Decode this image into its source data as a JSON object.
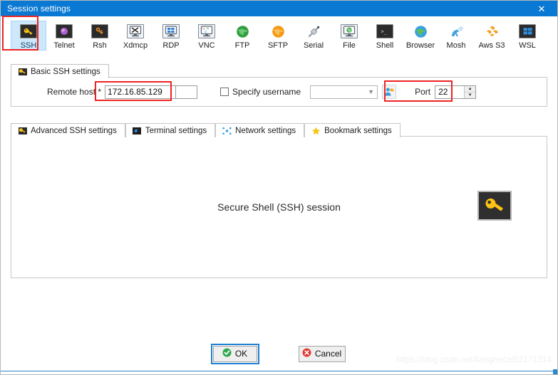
{
  "window": {
    "title": "Session settings",
    "close_label": "✕",
    "accent": "#0a79d4"
  },
  "toolbar": {
    "items": [
      {
        "label": "SSH",
        "icon": "ssh-key-icon",
        "selected": true
      },
      {
        "label": "Telnet",
        "icon": "telnet-icon",
        "selected": false
      },
      {
        "label": "Rsh",
        "icon": "rsh-icon",
        "selected": false
      },
      {
        "label": "Xdmcp",
        "icon": "xdmcp-icon",
        "selected": false
      },
      {
        "label": "RDP",
        "icon": "rdp-icon",
        "selected": false
      },
      {
        "label": "VNC",
        "icon": "vnc-icon",
        "selected": false
      },
      {
        "label": "FTP",
        "icon": "ftp-globe-icon",
        "selected": false
      },
      {
        "label": "SFTP",
        "icon": "sftp-globe-icon",
        "selected": false
      },
      {
        "label": "Serial",
        "icon": "serial-plug-icon",
        "selected": false
      },
      {
        "label": "File",
        "icon": "file-monitor-icon",
        "selected": false
      },
      {
        "label": "Shell",
        "icon": "shell-icon",
        "selected": false
      },
      {
        "label": "Browser",
        "icon": "browser-globe-icon",
        "selected": false
      },
      {
        "label": "Mosh",
        "icon": "mosh-dish-icon",
        "selected": false
      },
      {
        "label": "Aws S3",
        "icon": "aws-s3-icon",
        "selected": false
      },
      {
        "label": "WSL",
        "icon": "wsl-windows-icon",
        "selected": false
      }
    ]
  },
  "basic": {
    "tab_label": "Basic SSH settings",
    "tab_icon": "ssh-key-icon",
    "remote_host_label": "Remote host *",
    "remote_host_value": "172.16.85.129",
    "remote_host_placeholder": "",
    "specify_username_label": "Specify username",
    "specify_username_checked": false,
    "username_value": "",
    "username_placeholder": "",
    "user_button_icon": "user-key-icon",
    "port_label": "Port",
    "port_value": "22",
    "spin_up": "▲",
    "spin_down": "▼"
  },
  "settings_tabs": [
    {
      "label": "Advanced SSH settings",
      "icon": "ssh-key-icon",
      "active": true
    },
    {
      "label": "Terminal settings",
      "icon": "terminal-icon",
      "active": false
    },
    {
      "label": "Network settings",
      "icon": "network-icon",
      "active": false
    },
    {
      "label": "Bookmark settings",
      "icon": "star-icon",
      "active": false
    }
  ],
  "content": {
    "heading": "Secure Shell (SSH) session",
    "badge_icon": "key-icon"
  },
  "footer": {
    "ok_label": "OK",
    "cancel_label": "Cancel",
    "ok_icon": "check-circle-icon",
    "cancel_icon": "x-circle-icon"
  },
  "watermark": {
    "text": "https://blog.csdn.net/lianghecai52171314"
  },
  "annotations": {
    "color": "#ee2222",
    "boxes": [
      "ssh-toolbar-item",
      "remote-host-input",
      "port-spinner"
    ]
  }
}
